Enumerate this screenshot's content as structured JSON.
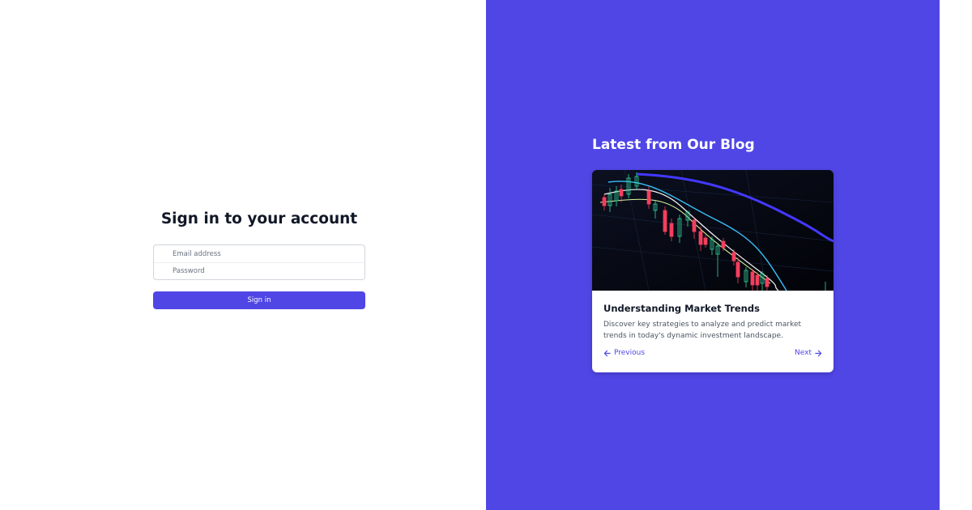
{
  "signin": {
    "title": "Sign in to your account",
    "email_placeholder": "Email address",
    "password_placeholder": "Password",
    "button_label": "Sign in"
  },
  "blog": {
    "heading": "Latest from Our Blog",
    "post": {
      "image_icon": "candlestick-chart-image",
      "title": "Understanding Market Trends",
      "description": "Discover key strategies to analyze and predict market trends in today's dynamic investment landscape."
    },
    "nav": {
      "previous_label": "Previous",
      "next_label": "Next"
    }
  },
  "colors": {
    "accent": "#4f46e5",
    "heading_text": "#111827",
    "body_text": "#4b5563"
  }
}
